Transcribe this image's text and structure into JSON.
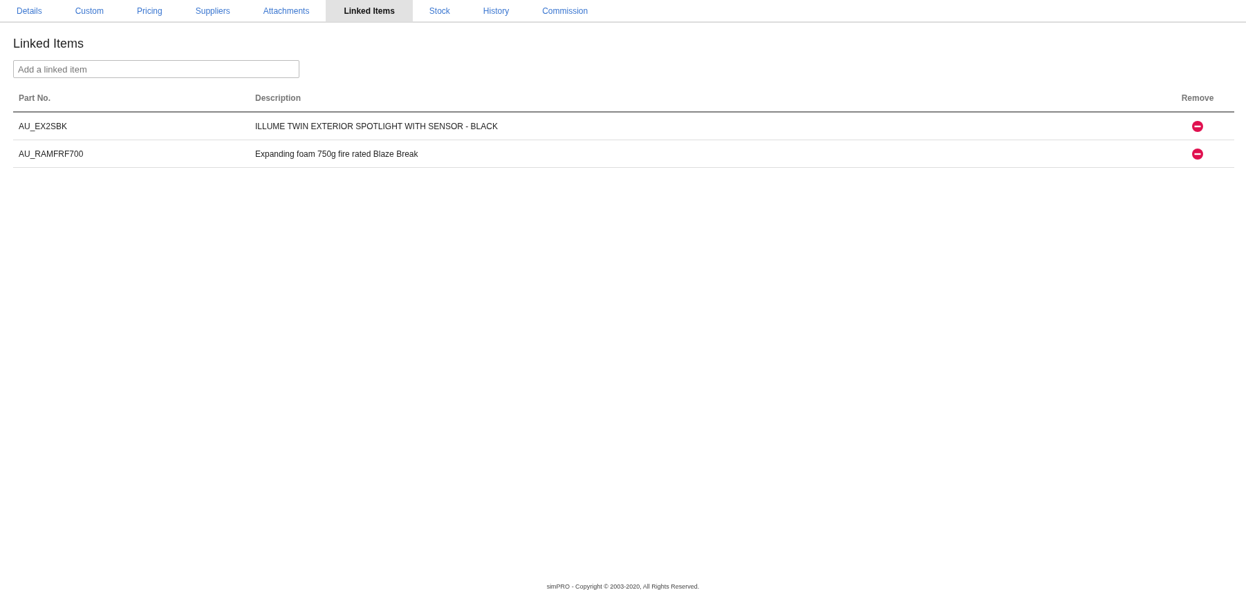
{
  "tabs": [
    {
      "label": "Details",
      "selected": false
    },
    {
      "label": "Custom",
      "selected": false
    },
    {
      "label": "Pricing",
      "selected": false
    },
    {
      "label": "Suppliers",
      "selected": false
    },
    {
      "label": "Attachments",
      "selected": false
    },
    {
      "label": "Linked Items",
      "selected": true
    },
    {
      "label": "Stock",
      "selected": false
    },
    {
      "label": "History",
      "selected": false
    },
    {
      "label": "Commission",
      "selected": false
    }
  ],
  "heading": "Linked Items",
  "search": {
    "placeholder": "Add a linked item"
  },
  "table": {
    "columns": [
      "Part No.",
      "Description",
      "Remove"
    ],
    "rows": [
      {
        "part_no": "AU_EX2SBK",
        "description": "ILLUME TWIN EXTERIOR SPOTLIGHT WITH SENSOR - BLACK"
      },
      {
        "part_no": "AU_RAMFRF700",
        "description": "Expanding foam 750g fire rated Blaze Break"
      }
    ]
  },
  "footer": "simPRO - Copyright © 2003-2020, All Rights Reserved."
}
